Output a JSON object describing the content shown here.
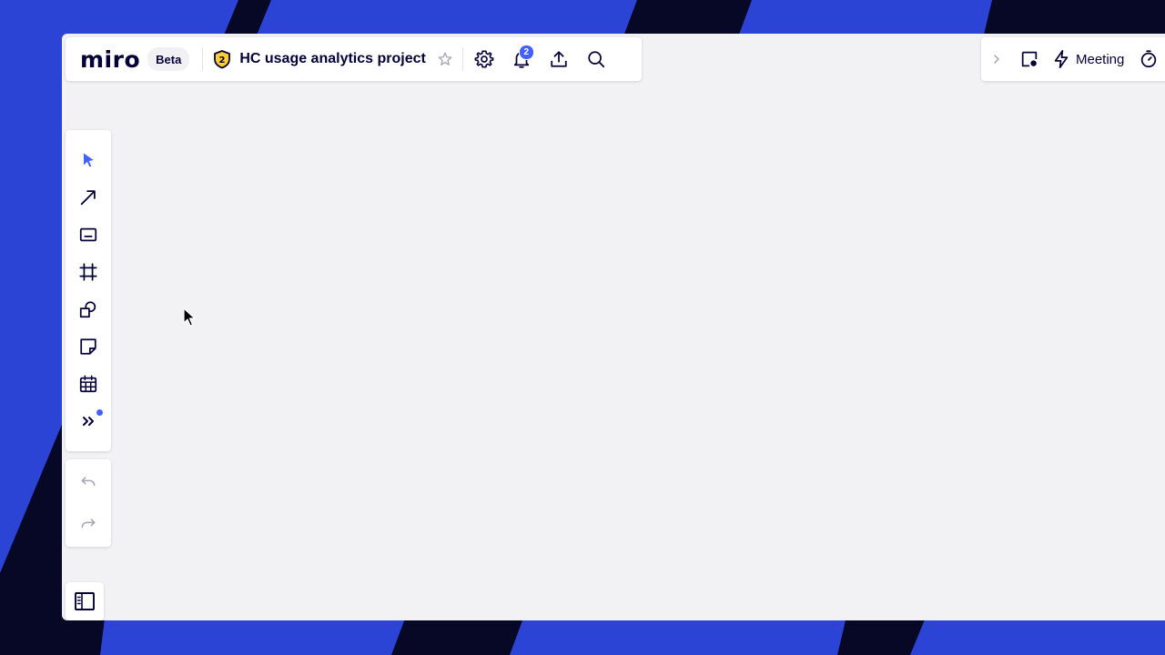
{
  "app": {
    "logo_text": "miro",
    "beta_label": "Beta"
  },
  "board": {
    "title": "HC usage analytics project",
    "shield_number": "2"
  },
  "header": {
    "notifications_count": "2",
    "icons": [
      "star-icon",
      "gear-icon",
      "bell-icon",
      "upload-icon",
      "search-icon"
    ]
  },
  "right_bar": {
    "meeting_label": "Meeting",
    "icons": [
      "chevron-right-icon",
      "card-icon",
      "lightning-icon",
      "timer-icon"
    ]
  },
  "toolbar": {
    "tools": [
      "select-tool",
      "line-tool",
      "text-tool",
      "frame-tool",
      "shapes-tool",
      "sticky-note-tool",
      "calendar-tool",
      "more-tools"
    ],
    "more_has_new": true
  },
  "colors": {
    "accent": "#4262ff",
    "text": "#050038",
    "background_blue": "#2b44d6",
    "background_navy": "#060825",
    "canvas": "#f2f2f4"
  }
}
